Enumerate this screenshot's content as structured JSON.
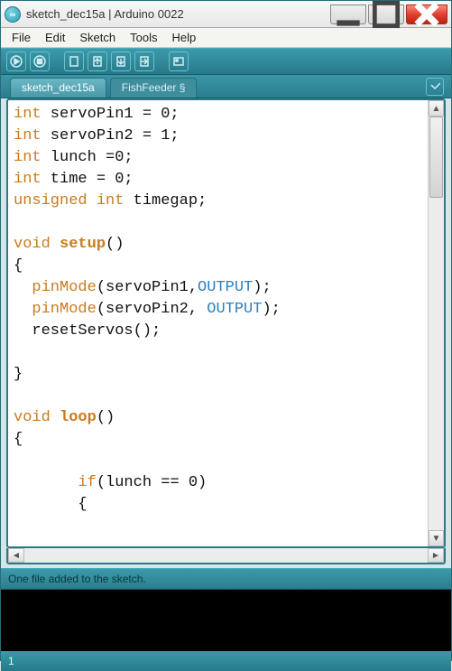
{
  "window": {
    "title": "sketch_dec15a | Arduino 0022",
    "icon_label": "∞"
  },
  "menu": {
    "items": [
      "File",
      "Edit",
      "Sketch",
      "Tools",
      "Help"
    ]
  },
  "toolbar": {
    "buttons": [
      {
        "name": "verify-button",
        "icon": "play"
      },
      {
        "name": "stop-button",
        "icon": "stop"
      },
      {
        "name": "new-button",
        "icon": "new"
      },
      {
        "name": "open-button",
        "icon": "open"
      },
      {
        "name": "save-button",
        "icon": "save"
      },
      {
        "name": "upload-button",
        "icon": "upload"
      },
      {
        "name": "serial-monitor-button",
        "icon": "serial"
      }
    ]
  },
  "tabs": {
    "items": [
      {
        "label": "sketch_dec15a",
        "active": true
      },
      {
        "label": "FishFeeder §",
        "active": false
      }
    ]
  },
  "code": {
    "tokens": [
      [
        [
          "kw-type",
          "int"
        ],
        [
          "",
          " servoPin1 = 0;"
        ]
      ],
      [
        [
          "kw-type",
          "int"
        ],
        [
          "",
          " servoPin2 = 1;"
        ]
      ],
      [
        [
          "kw-type",
          "int"
        ],
        [
          "",
          " lunch =0;"
        ]
      ],
      [
        [
          "kw-type",
          "int"
        ],
        [
          "",
          " time = 0;"
        ]
      ],
      [
        [
          "kw-type",
          "unsigned int"
        ],
        [
          "",
          " timegap;"
        ]
      ],
      [
        [
          "",
          ""
        ]
      ],
      [
        [
          "kw-type",
          "void"
        ],
        [
          "",
          " "
        ],
        [
          "kw-stg",
          "setup"
        ],
        [
          "",
          "()"
        ]
      ],
      [
        [
          "",
          "{"
        ]
      ],
      [
        [
          "",
          "  "
        ],
        [
          "kw-fn",
          "pinMode"
        ],
        [
          "",
          "(servoPin1,"
        ],
        [
          "kw-cst",
          "OUTPUT"
        ],
        [
          "",
          ");"
        ]
      ],
      [
        [
          "",
          "  "
        ],
        [
          "kw-fn",
          "pinMode"
        ],
        [
          "",
          "(servoPin2, "
        ],
        [
          "kw-cst",
          "OUTPUT"
        ],
        [
          "",
          ");"
        ]
      ],
      [
        [
          "",
          "  resetServos();"
        ]
      ],
      [
        [
          "",
          ""
        ]
      ],
      [
        [
          "",
          "}"
        ]
      ],
      [
        [
          "",
          ""
        ]
      ],
      [
        [
          "kw-type",
          "void"
        ],
        [
          "",
          " "
        ],
        [
          "kw-stg",
          "loop"
        ],
        [
          "",
          "()"
        ]
      ],
      [
        [
          "",
          "{"
        ]
      ],
      [
        [
          "",
          ""
        ]
      ],
      [
        [
          "",
          "       "
        ],
        [
          "kw-fn",
          "if"
        ],
        [
          "",
          "(lunch == 0)"
        ]
      ],
      [
        [
          "",
          "       {"
        ]
      ]
    ]
  },
  "status": {
    "message": "One file added to the sketch."
  },
  "footer": {
    "line_indicator": "1"
  }
}
